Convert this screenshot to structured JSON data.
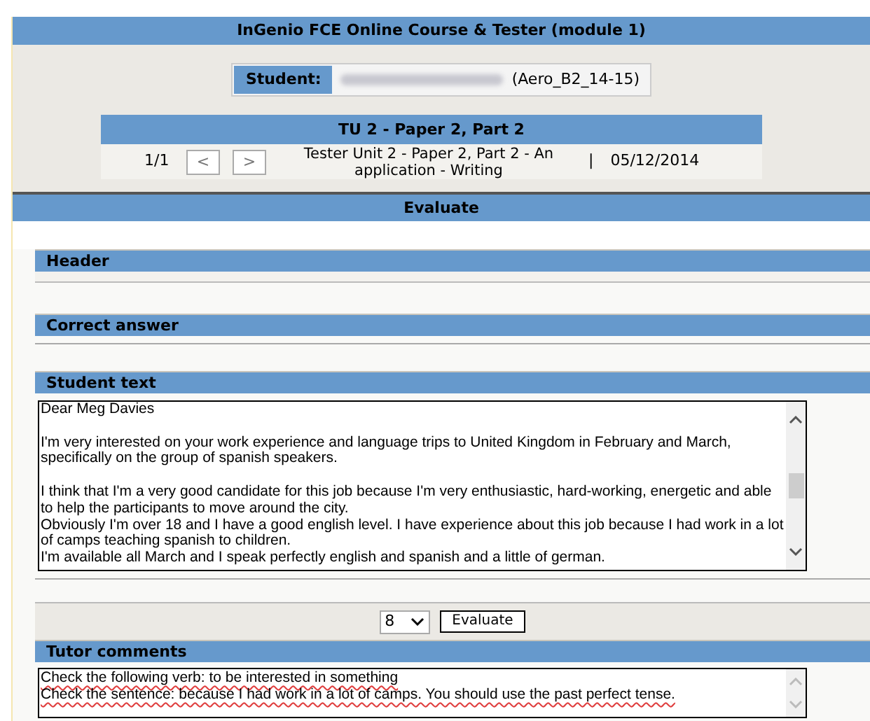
{
  "window": {
    "title": "InGenio FCE Online Course & Tester (module 1)"
  },
  "student": {
    "label": "Student:",
    "group": "(Aero_B2_14-15)"
  },
  "task": {
    "title": "TU 2 - Paper 2, Part 2",
    "counter": "1/1",
    "prev": "<",
    "next": ">",
    "description": "Tester Unit 2 - Paper 2, Part 2 - An application - Writing",
    "separator": "|",
    "date": "05/12/2014"
  },
  "evaluate_title": "Evaluate",
  "sections": [
    {
      "kind": "band",
      "title": "Header"
    },
    {
      "kind": "empty",
      "title": "Correct answer"
    },
    {
      "kind": "text",
      "title": "Student text",
      "text": "Dear Meg Davies\n\nI'm very interested on your work experience and language trips to United Kingdom in February and March, specifically on the group of spanish speakers.\n\nI think that I'm a very good candidate for this job because I'm very enthusiastic, hard-working, energetic and able to help the participants to move around the city.\nObviously I'm over 18 and I have a good english level. I have experience about this job because I had work in a lot of camps teaching spanish to children.\nI'm available all March and I speak perfectly english and spanish and a little of german."
    }
  ],
  "grading": {
    "grade": "8",
    "button": "Evaluate"
  },
  "tutor_comments": {
    "title": "Tutor comments",
    "text": "Check the following verb: to be interested in something\nCheck the sentence: because I had work in a lot of camps. You should use the past perfect tense."
  }
}
